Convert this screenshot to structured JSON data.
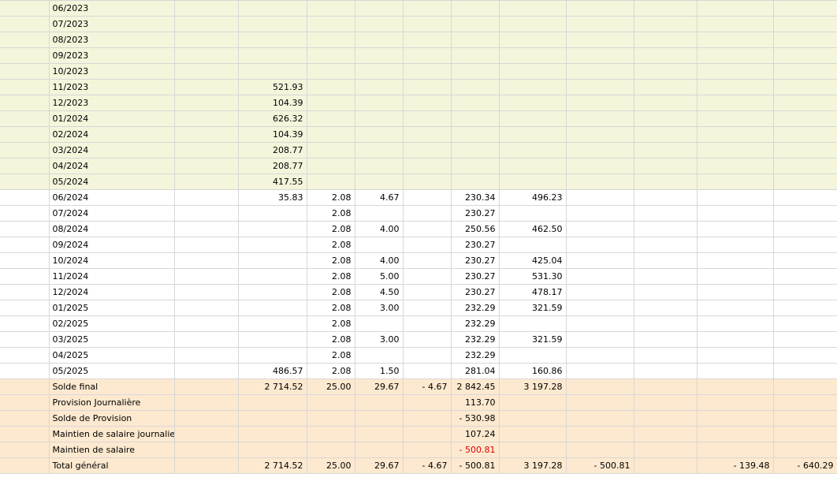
{
  "rows": [
    {
      "label": "06/2023",
      "kind": "hist",
      "c1": "",
      "c2": "",
      "c3": "",
      "c4": "",
      "c5": "",
      "c6": "",
      "c7": "",
      "c8": "",
      "c9": "",
      "c10": ""
    },
    {
      "label": "07/2023",
      "kind": "hist",
      "c1": "",
      "c2": "",
      "c3": "",
      "c4": "",
      "c5": "",
      "c6": "",
      "c7": "",
      "c8": "",
      "c9": "",
      "c10": ""
    },
    {
      "label": "08/2023",
      "kind": "hist",
      "c1": "",
      "c2": "",
      "c3": "",
      "c4": "",
      "c5": "",
      "c6": "",
      "c7": "",
      "c8": "",
      "c9": "",
      "c10": ""
    },
    {
      "label": "09/2023",
      "kind": "hist",
      "c1": "",
      "c2": "",
      "c3": "",
      "c4": "",
      "c5": "",
      "c6": "",
      "c7": "",
      "c8": "",
      "c9": "",
      "c10": ""
    },
    {
      "label": "10/2023",
      "kind": "hist",
      "c1": "",
      "c2": "",
      "c3": "",
      "c4": "",
      "c5": "",
      "c6": "",
      "c7": "",
      "c8": "",
      "c9": "",
      "c10": ""
    },
    {
      "label": "11/2023",
      "kind": "hist",
      "c1": "521.93",
      "c2": "",
      "c3": "",
      "c4": "",
      "c5": "",
      "c6": "",
      "c7": "",
      "c8": "",
      "c9": "",
      "c10": ""
    },
    {
      "label": "12/2023",
      "kind": "hist",
      "c1": "104.39",
      "c2": "",
      "c3": "",
      "c4": "",
      "c5": "",
      "c6": "",
      "c7": "",
      "c8": "",
      "c9": "",
      "c10": ""
    },
    {
      "label": "01/2024",
      "kind": "hist",
      "c1": "626.32",
      "c2": "",
      "c3": "",
      "c4": "",
      "c5": "",
      "c6": "",
      "c7": "",
      "c8": "",
      "c9": "",
      "c10": ""
    },
    {
      "label": "02/2024",
      "kind": "hist",
      "c1": "104.39",
      "c2": "",
      "c3": "",
      "c4": "",
      "c5": "",
      "c6": "",
      "c7": "",
      "c8": "",
      "c9": "",
      "c10": ""
    },
    {
      "label": "03/2024",
      "kind": "hist",
      "c1": "208.77",
      "c2": "",
      "c3": "",
      "c4": "",
      "c5": "",
      "c6": "",
      "c7": "",
      "c8": "",
      "c9": "",
      "c10": ""
    },
    {
      "label": "04/2024",
      "kind": "hist",
      "c1": "208.77",
      "c2": "",
      "c3": "",
      "c4": "",
      "c5": "",
      "c6": "",
      "c7": "",
      "c8": "",
      "c9": "",
      "c10": ""
    },
    {
      "label": "05/2024",
      "kind": "hist",
      "c1": "417.55",
      "c2": "",
      "c3": "",
      "c4": "",
      "c5": "",
      "c6": "",
      "c7": "",
      "c8": "",
      "c9": "",
      "c10": ""
    },
    {
      "label": "06/2024",
      "kind": "cur",
      "c1": "35.83",
      "c2": "2.08",
      "c3": "4.67",
      "c4": "",
      "c5": "230.34",
      "c6": "496.23",
      "c7": "",
      "c8": "",
      "c9": "",
      "c10": ""
    },
    {
      "label": "07/2024",
      "kind": "cur",
      "c1": "",
      "c2": "2.08",
      "c3": "",
      "c4": "",
      "c5": "230.27",
      "c6": "",
      "c7": "",
      "c8": "",
      "c9": "",
      "c10": ""
    },
    {
      "label": "08/2024",
      "kind": "cur",
      "c1": "",
      "c2": "2.08",
      "c3": "4.00",
      "c4": "",
      "c5": "250.56",
      "c6": "462.50",
      "c7": "",
      "c8": "",
      "c9": "",
      "c10": ""
    },
    {
      "label": "09/2024",
      "kind": "cur",
      "c1": "",
      "c2": "2.08",
      "c3": "",
      "c4": "",
      "c5": "230.27",
      "c6": "",
      "c7": "",
      "c8": "",
      "c9": "",
      "c10": ""
    },
    {
      "label": "10/2024",
      "kind": "cur",
      "c1": "",
      "c2": "2.08",
      "c3": "4.00",
      "c4": "",
      "c5": "230.27",
      "c6": "425.04",
      "c7": "",
      "c8": "",
      "c9": "",
      "c10": ""
    },
    {
      "label": "11/2024",
      "kind": "cur",
      "c1": "",
      "c2": "2.08",
      "c3": "5.00",
      "c4": "",
      "c5": "230.27",
      "c6": "531.30",
      "c7": "",
      "c8": "",
      "c9": "",
      "c10": ""
    },
    {
      "label": "12/2024",
      "kind": "cur",
      "c1": "",
      "c2": "2.08",
      "c3": "4.50",
      "c4": "",
      "c5": "230.27",
      "c6": "478.17",
      "c7": "",
      "c8": "",
      "c9": "",
      "c10": ""
    },
    {
      "label": "01/2025",
      "kind": "cur",
      "c1": "",
      "c2": "2.08",
      "c3": "3.00",
      "c4": "",
      "c5": "232.29",
      "c6": "321.59",
      "c7": "",
      "c8": "",
      "c9": "",
      "c10": ""
    },
    {
      "label": "02/2025",
      "kind": "cur",
      "c1": "",
      "c2": "2.08",
      "c3": "",
      "c4": "",
      "c5": "232.29",
      "c6": "",
      "c7": "",
      "c8": "",
      "c9": "",
      "c10": ""
    },
    {
      "label": "03/2025",
      "kind": "cur",
      "c1": "",
      "c2": "2.08",
      "c3": "3.00",
      "c4": "",
      "c5": "232.29",
      "c6": "321.59",
      "c7": "",
      "c8": "",
      "c9": "",
      "c10": ""
    },
    {
      "label": "04/2025",
      "kind": "cur",
      "c1": "",
      "c2": "2.08",
      "c3": "",
      "c4": "",
      "c5": "232.29",
      "c6": "",
      "c7": "",
      "c8": "",
      "c9": "",
      "c10": ""
    },
    {
      "label": "05/2025",
      "kind": "cur dotted",
      "c1": "486.57",
      "c2": "2.08",
      "c3": "1.50",
      "c4": "",
      "c5": "281.04",
      "c6": "160.86",
      "c7": "",
      "c8": "",
      "c9": "",
      "c10": ""
    },
    {
      "label": "Solde final",
      "kind": "tot",
      "c1": "2 714.52",
      "c2": "25.00",
      "c3": "29.67",
      "c4": "- 4.67",
      "c5": "2 842.45",
      "c6": "3 197.28",
      "c7": "",
      "c8": "",
      "c9": "",
      "c10": ""
    },
    {
      "label": "Provision Journalière",
      "kind": "tot",
      "c1": "",
      "c2": "",
      "c3": "",
      "c4": "",
      "c5": "113.70",
      "c6": "",
      "c7": "",
      "c8": "",
      "c9": "",
      "c10": ""
    },
    {
      "label": "Solde de Provision",
      "kind": "tot",
      "c1": "",
      "c2": "",
      "c3": "",
      "c4": "",
      "c5": "- 530.98",
      "c6": "",
      "c7": "",
      "c8": "",
      "c9": "",
      "c10": ""
    },
    {
      "label": "Maintien de salaire journalier",
      "kind": "tot",
      "c1": "",
      "c2": "",
      "c3": "",
      "c4": "",
      "c5": "107.24",
      "c6": "",
      "c7": "",
      "c8": "",
      "c9": "",
      "c10": ""
    },
    {
      "label": "Maintien de salaire",
      "kind": "tot",
      "c1": "",
      "c2": "",
      "c3": "",
      "c4": "",
      "c5": "- 500.81",
      "c5_red": true,
      "c6": "",
      "c7": "",
      "c8": "",
      "c9": "",
      "c10": ""
    },
    {
      "label": "Total général",
      "kind": "tot",
      "c1": "2 714.52",
      "c2": "25.00",
      "c3": "29.67",
      "c4": "- 4.67",
      "c5": "- 500.81",
      "c6": "3 197.28",
      "c7": "- 500.81",
      "c8": "",
      "c9": "- 139.48",
      "c10": "- 640.29"
    }
  ],
  "colors": {
    "history_bg": "#f5f5dc",
    "total_bg": "#fde9cf",
    "negative_red": "#e00000"
  }
}
